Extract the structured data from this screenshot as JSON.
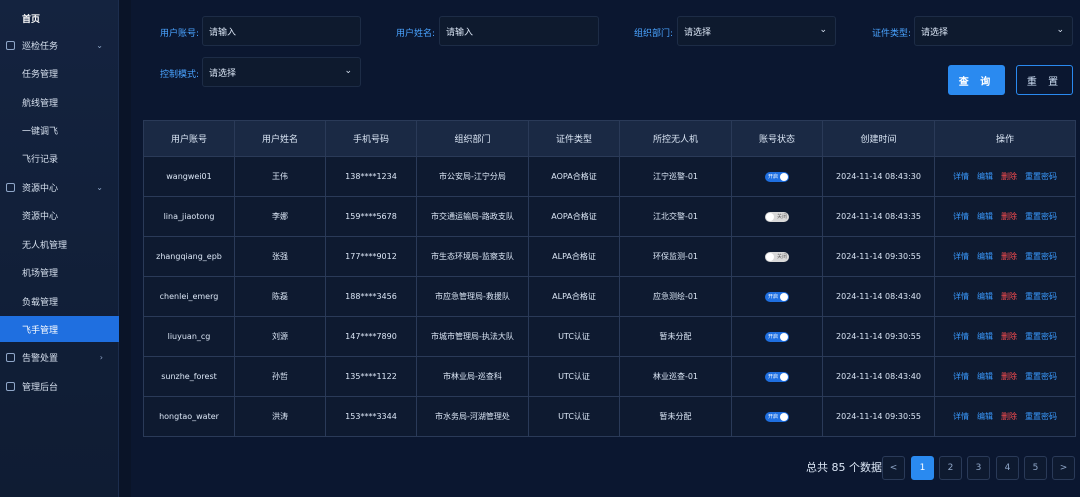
{
  "sidebar": {
    "items": [
      {
        "label": "首页"
      },
      {
        "label": "巡检任务"
      },
      {
        "label": "任务管理"
      },
      {
        "label": "航线管理"
      },
      {
        "label": "一键调飞"
      },
      {
        "label": "飞行记录"
      },
      {
        "label": "资源中心"
      },
      {
        "label": "资源中心"
      },
      {
        "label": "无人机管理"
      },
      {
        "label": "机场管理"
      },
      {
        "label": "负载管理"
      },
      {
        "label": "飞手管理"
      },
      {
        "label": "告警处置"
      },
      {
        "label": "管理后台"
      }
    ]
  },
  "filters": {
    "account_label": "用户账号:",
    "account_placeholder": "请输入",
    "name_label": "用户姓名:",
    "name_placeholder": "请输入",
    "org_label": "组织部门:",
    "org_value": "请选择",
    "cert_label": "证件类型:",
    "cert_value": "请选择",
    "mode_label": "控制模式:",
    "mode_value": "请选择",
    "query_label": "查 询",
    "reset_label": "重 置"
  },
  "table": {
    "headers": [
      "用户账号",
      "用户姓名",
      "手机号码",
      "组织部门",
      "证件类型",
      "所控无人机",
      "账号状态",
      "创建时间",
      "操作"
    ],
    "rows": [
      {
        "account": "wangwei01",
        "name": "王伟",
        "phone": "138****1234",
        "org": "市公安局-江宁分局",
        "cert": "AOPA合格证",
        "drone": "江宁巡警-01",
        "status": "开启",
        "on": true,
        "created": "2024-11-14 08:43:30"
      },
      {
        "account": "lina_jiaotong",
        "name": "李娜",
        "phone": "159****5678",
        "org": "市交通运输局-路政支队",
        "cert": "AOPA合格证",
        "drone": "江北交警-01",
        "status": "关闭",
        "on": false,
        "created": "2024-11-14 08:43:35"
      },
      {
        "account": "zhangqiang_epb",
        "name": "张强",
        "phone": "177****9012",
        "org": "市生态环境局-监察支队",
        "cert": "ALPA合格证",
        "drone": "环保监测-01",
        "status": "关闭",
        "on": false,
        "created": "2024-11-14 09:30:55"
      },
      {
        "account": "chenlei_emerg",
        "name": "陈磊",
        "phone": "188****3456",
        "org": "市应急管理局-救援队",
        "cert": "ALPA合格证",
        "drone": "应急测绘-01",
        "status": "开启",
        "on": true,
        "created": "2024-11-14 08:43:40"
      },
      {
        "account": "liuyuan_cg",
        "name": "刘源",
        "phone": "147****7890",
        "org": "市城市管理局-执法大队",
        "cert": "UTC认证",
        "drone": "暂未分配",
        "status": "开启",
        "on": true,
        "created": "2024-11-14 09:30:55"
      },
      {
        "account": "sunzhe_forest",
        "name": "孙哲",
        "phone": "135****1122",
        "org": "市林业局-巡查科",
        "cert": "UTC认证",
        "drone": "林业巡查-01",
        "status": "开启",
        "on": true,
        "created": "2024-11-14 08:43:40"
      },
      {
        "account": "hongtao_water",
        "name": "洪涛",
        "phone": "153****3344",
        "org": "市水务局-河湖管理处",
        "cert": "UTC认证",
        "drone": "暂未分配",
        "status": "开启",
        "on": true,
        "created": "2024-11-14 09:30:55"
      }
    ],
    "ops": {
      "detail": "详情",
      "edit": "编辑",
      "delete": "删除",
      "reset_pwd": "重置密码"
    }
  },
  "pagination": {
    "total_text": "总共 85 个数据",
    "prev": "<",
    "next": ">",
    "pages": [
      "1",
      "2",
      "3",
      "4",
      "5"
    ],
    "current": "1"
  }
}
